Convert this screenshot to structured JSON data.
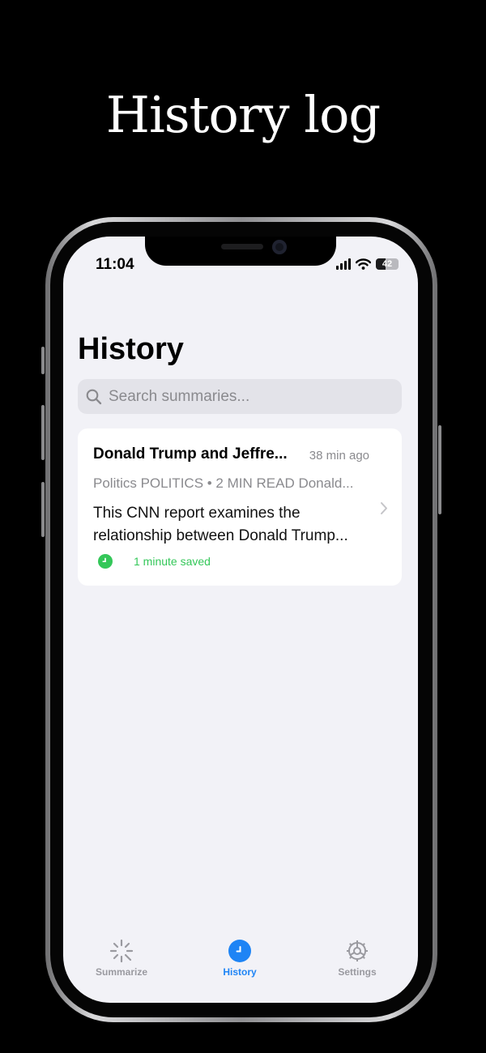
{
  "promo": {
    "headline": "History log"
  },
  "status_bar": {
    "time": "11:04",
    "battery_level": "42"
  },
  "page": {
    "title": "History"
  },
  "search": {
    "placeholder": "Search summaries..."
  },
  "history_items": [
    {
      "title": "Donald Trump and Jeffre...",
      "time_ago": "38 min ago",
      "meta": "Politics  POLITICS • 2 MIN READ Donald...",
      "summary": "This CNN report examines the relationship between Donald Trump...",
      "time_saved": "1 minute saved"
    }
  ],
  "tab_bar": {
    "tabs": [
      {
        "label": "Summarize",
        "icon": "sparkle-icon",
        "active": false
      },
      {
        "label": "History",
        "icon": "clock-icon",
        "active": true
      },
      {
        "label": "Settings",
        "icon": "gear-icon",
        "active": false
      }
    ]
  },
  "colors": {
    "accent": "#1e84f5",
    "success": "#34c759",
    "background": "#f2f2f7",
    "card": "#ffffff",
    "secondary_text": "#8a8a8e"
  }
}
